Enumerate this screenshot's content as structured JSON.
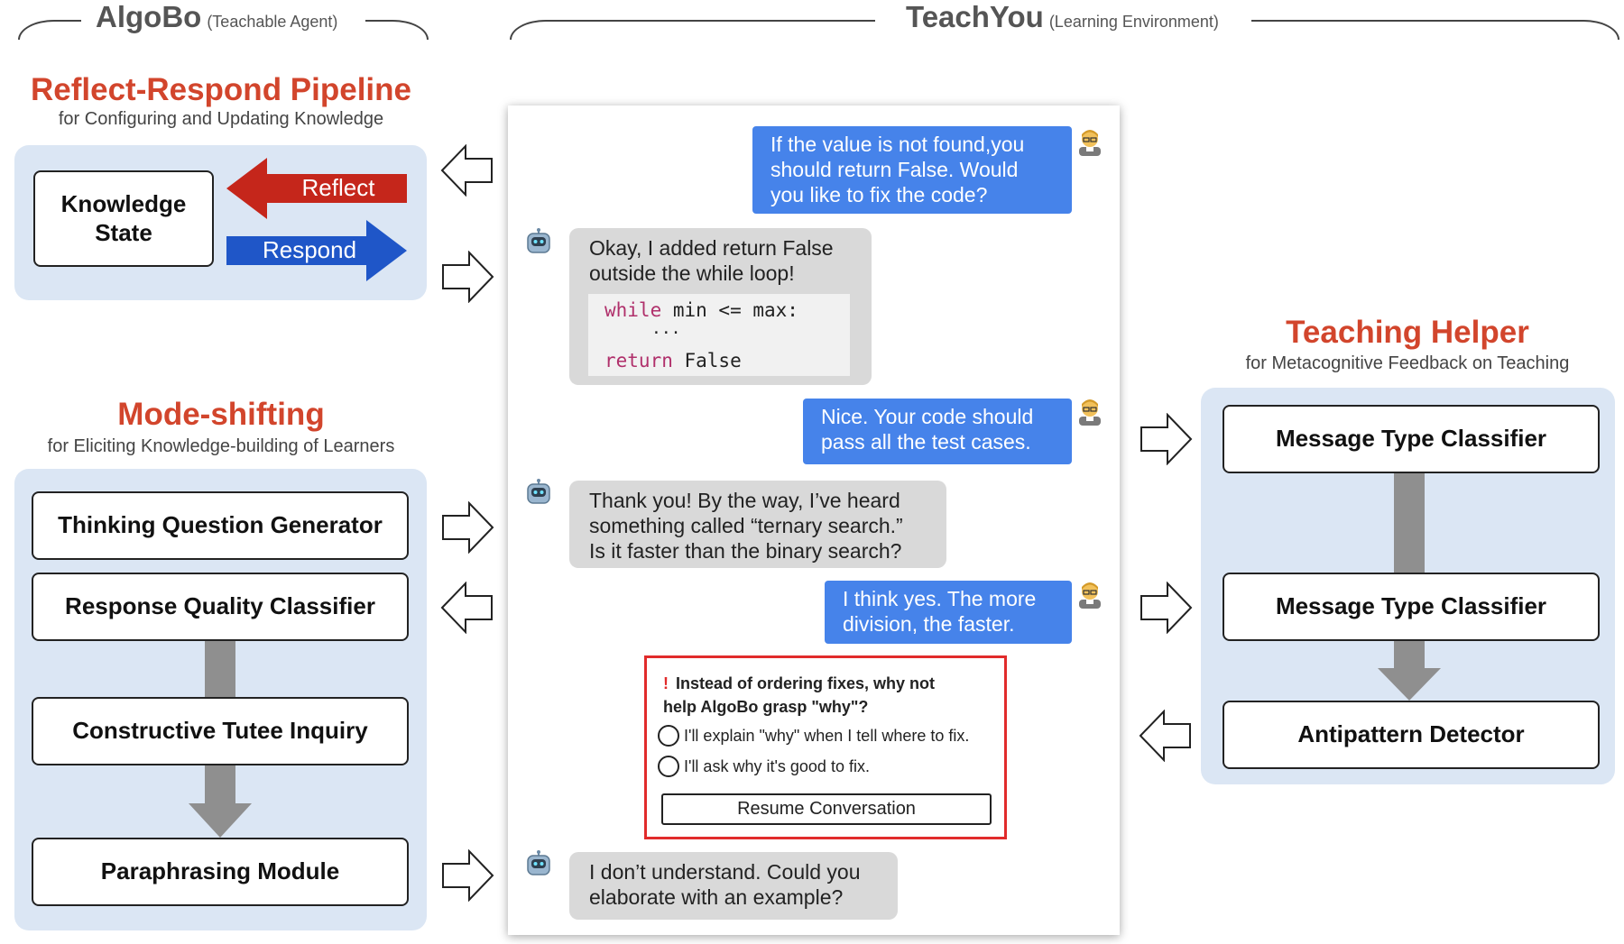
{
  "headers": {
    "algobo_name": "AlgoBo",
    "algobo_desc": "(Teachable Agent)",
    "teachyou_name": "TeachYou",
    "teachyou_desc": "(Learning Environment)"
  },
  "reflect_respond": {
    "title": "Reflect-Respond Pipeline",
    "subtitle": "for Configuring and Updating Knowledge",
    "knowledge_state": "Knowledge State",
    "reflect_label": "Reflect",
    "respond_label": "Respond",
    "reflect_color": "#c5261b",
    "respond_color": "#1f56c8"
  },
  "mode_shifting": {
    "title": "Mode-shifting",
    "subtitle": "for Eliciting Knowledge-building of Learners",
    "items": [
      "Thinking Question Generator",
      "Response Quality Classifier",
      "Constructive Tutee Inquiry",
      "Paraphrasing Module"
    ]
  },
  "teaching_helper": {
    "title": "Teaching Helper",
    "subtitle": "for Metacognitive Feedback on Teaching",
    "items": [
      "Message Type Classifier",
      "Message Type Classifier",
      "Antipattern Detector"
    ]
  },
  "chat": {
    "msg1_lines": [
      "If the value is not found,you",
      "should return False. Would",
      "you like to fix the code?"
    ],
    "msg2_lines": [
      "Okay, I added return False",
      "outside the while loop!"
    ],
    "code_kw1": "while",
    "code_rest1": " min <= max:",
    "code_ellipsis": "...",
    "code_kw2": "return",
    "code_rest2": " False",
    "msg3_lines": [
      "Nice. Your code should",
      "pass all the test cases."
    ],
    "msg4_lines": [
      "Thank you! By the way, I’ve heard",
      "something called “ternary search.”",
      "Is it faster than the binary search?"
    ],
    "msg5_lines": [
      "I think yes. The more",
      "division, the faster."
    ],
    "alert_mark": "!",
    "alert_line1": "Instead of ordering fixes, why not",
    "alert_line2": "help AlgoBo grasp \"why\"?",
    "option1": "I'll explain \"why\" when I tell where to fix.",
    "option2": "I'll ask why it's good to fix.",
    "resume": "Resume Conversation",
    "msg6_lines": [
      "I don’t understand. Could you",
      "elaborate with an example?"
    ],
    "user_color": "#4683ea",
    "bot_color": "#d9d9d9",
    "alert_color": "#e12b2b"
  }
}
